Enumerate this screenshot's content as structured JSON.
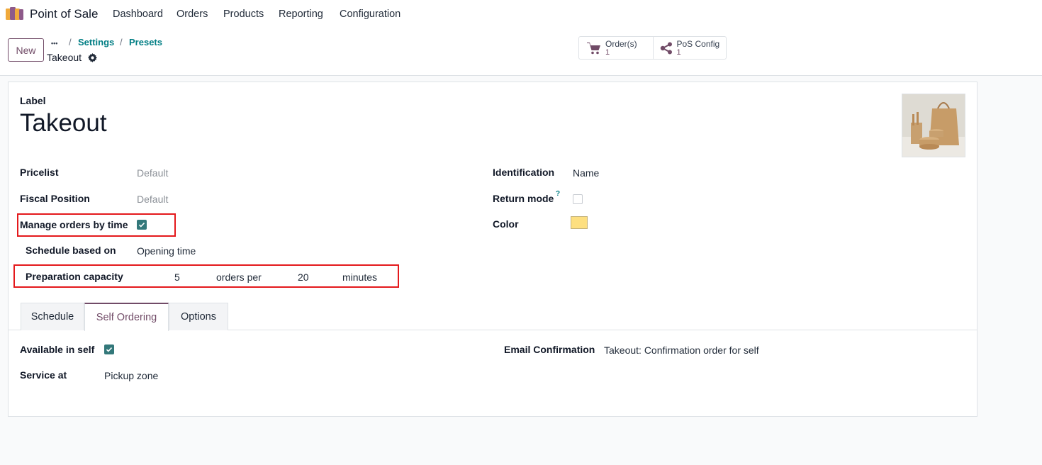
{
  "topnav": {
    "app_name": "Point of Sale",
    "app_icon": "pos-app-icon",
    "menu": [
      "Dashboard",
      "Orders",
      "Products",
      "Reporting",
      "Configuration"
    ]
  },
  "control_panel": {
    "new_label": "New",
    "breadcrumb_dots": "•••",
    "breadcrumb": [
      "Settings",
      "Presets"
    ],
    "breadcrumb_sep": "/",
    "record_title": "Takeout",
    "smart_buttons": [
      {
        "icon": "cart-icon",
        "label": "Order(s)",
        "value": "1"
      },
      {
        "icon": "share-icon",
        "label": "PoS Config",
        "value": "1"
      }
    ]
  },
  "form": {
    "label_title": "Label",
    "label_value": "Takeout",
    "left": {
      "pricelist_label": "Pricelist",
      "pricelist_placeholder": "Default",
      "fiscal_label": "Fiscal Position",
      "fiscal_placeholder": "Default",
      "manage_label": "Manage orders by time",
      "manage_checked": true,
      "schedule_label": "Schedule based on",
      "schedule_value": "Opening time",
      "capacity_label": "Preparation capacity",
      "capacity_orders": "5",
      "capacity_orders_per": "orders per",
      "capacity_minutes": "20",
      "capacity_minutes_label": "minutes"
    },
    "right": {
      "identification_label": "Identification",
      "identification_value": "Name",
      "return_label": "Return mode",
      "return_help": "?",
      "return_checked": false,
      "color_label": "Color",
      "color_value": "#fddf80"
    },
    "tabs": [
      "Schedule",
      "Self Ordering",
      "Options"
    ],
    "active_tab": "Self Ordering",
    "tab_content": {
      "available_label": "Available in self",
      "available_checked": true,
      "service_label": "Service at",
      "service_value": "Pickup zone",
      "email_label": "Email Confirmation",
      "email_value": "Takeout: Confirmation order for self"
    }
  },
  "colors": {
    "brand": "#714b67",
    "link": "#017e84",
    "checkbox": "#33787a",
    "highlight": "#e4191c"
  }
}
